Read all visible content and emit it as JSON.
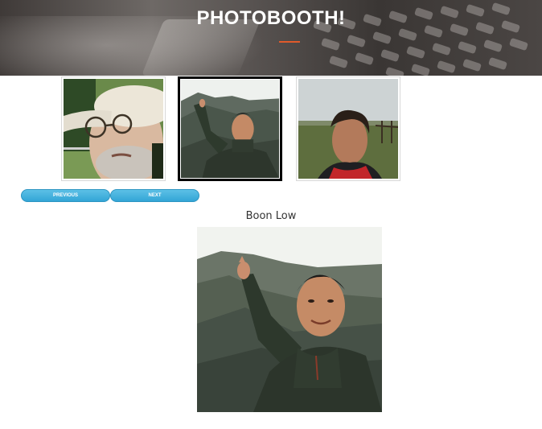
{
  "header": {
    "title": "PHOTOBOOTH!",
    "accent_color": "#e05a2b"
  },
  "gallery": {
    "thumbnails": [
      {
        "name": "thumb-older-man-cap",
        "selected": false
      },
      {
        "name": "thumb-boon-low",
        "selected": true
      },
      {
        "name": "thumb-man-red-collar",
        "selected": false
      }
    ],
    "previous_label": "PREVIOUS",
    "next_label": "NEXT",
    "button_color": "#3aaddc"
  },
  "selected": {
    "caption": "Boon Low"
  }
}
